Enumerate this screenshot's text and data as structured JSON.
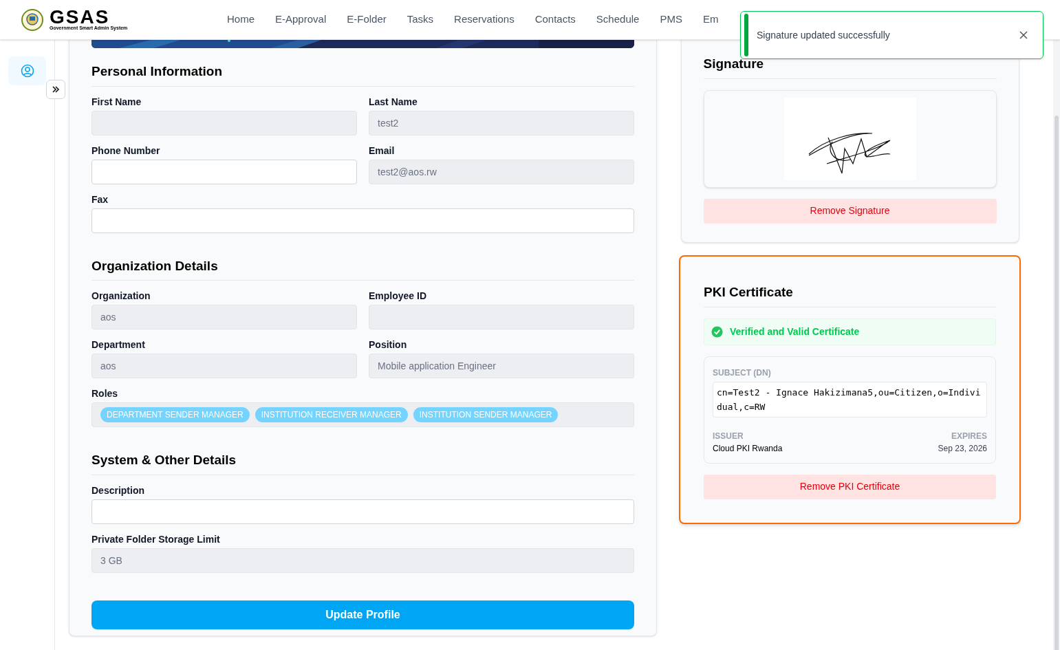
{
  "header": {
    "logo_title": "GSAS",
    "logo_subtitle": "Government Smart Admin System",
    "nav": [
      "Home",
      "E-Approval",
      "E-Folder",
      "Tasks",
      "Reservations",
      "Contacts",
      "Schedule",
      "PMS",
      "Em"
    ]
  },
  "toast": {
    "message": "Signature updated successfully"
  },
  "sidebar": {
    "items": [
      {
        "selected": true
      }
    ]
  },
  "sections": [
    {
      "title": "Personal Information",
      "rows": [
        [
          {
            "label": "First Name",
            "disabled": true
          },
          {
            "label": "Last Name",
            "value": "test2",
            "disabled": true
          }
        ],
        [
          {
            "label": "Phone Number",
            "disabled": false
          },
          {
            "label": "Email",
            "value": "test2@aos.rw",
            "disabled": true
          }
        ],
        [
          {
            "label": "Fax",
            "disabled": false
          }
        ]
      ]
    },
    {
      "title": "Organization Details",
      "rows": [
        [
          {
            "label": "Organization",
            "value": "aos",
            "disabled": true
          },
          {
            "label": "Employee ID",
            "disabled": true
          }
        ],
        [
          {
            "label": "Department",
            "value": "aos",
            "disabled": true
          },
          {
            "label": "Position",
            "value": "Mobile application Engineer",
            "disabled": true
          }
        ],
        [
          {
            "label": "Roles",
            "tags": [
              "DEPARTMENT SENDER MANAGER",
              "INSTITUTION RECEIVER MANAGER",
              "INSTITUTION SENDER MANAGER"
            ],
            "disabled": true
          }
        ]
      ]
    },
    {
      "title": "System & Other Details",
      "rows": [
        [
          {
            "label": "Description",
            "disabled": false
          }
        ],
        [
          {
            "label": "Private Folder Storage Limit",
            "value": "3 GB",
            "disabled": true
          }
        ]
      ]
    }
  ],
  "submit_button": "Update Profile",
  "signature": {
    "title": "Signature",
    "button": "Remove Signature"
  },
  "pki": {
    "title": "PKI Certificate",
    "highlighted": true,
    "status": "Verified and Valid Certificate",
    "subject_label": "SUBJECT (DN)",
    "subject": "cn=Test2 - Ignace Hakizimana5,ou=Citizen,o=Individual,c=RW",
    "issuer_label": "ISSUER",
    "issuer": "Cloud PKI Rwanda",
    "expires_label": "EXPIRES",
    "expires": "Sep 23, 2026",
    "button": "Remove PKI Certificate"
  }
}
